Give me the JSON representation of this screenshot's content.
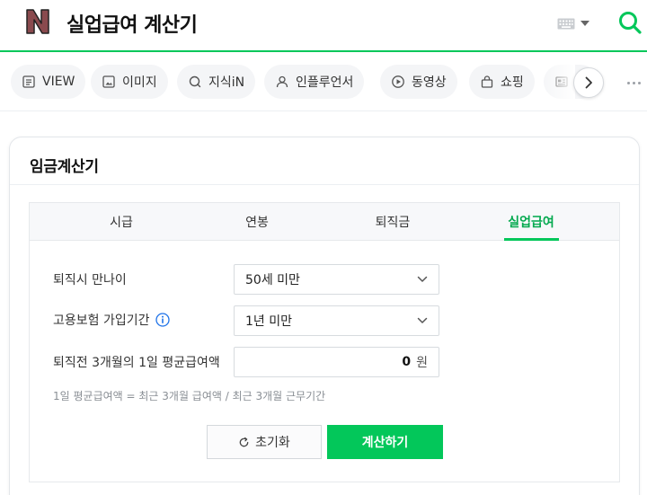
{
  "header": {
    "logo_letter": "N",
    "query": "실업급여 계산기"
  },
  "tabs": [
    {
      "label": "VIEW",
      "icon": "view-icon"
    },
    {
      "label": "이미지",
      "icon": "image-icon"
    },
    {
      "label": "지식iN",
      "icon": "knowledge-icon"
    },
    {
      "label": "인플루언서",
      "icon": "person-icon"
    },
    {
      "label": "동영상",
      "icon": "play-icon"
    },
    {
      "label": "쇼핑",
      "icon": "shopping-bag-icon"
    },
    {
      "label": "",
      "icon": "news-icon"
    }
  ],
  "card": {
    "title": "임금계산기",
    "calc_tabs": [
      "시급",
      "연봉",
      "퇴직금",
      "실업급여"
    ],
    "active_tab": "실업급여",
    "age_label": "퇴직시 만나이",
    "age_value": "50세 미만",
    "period_label": "고용보험 가입기간",
    "period_value": "1년 미만",
    "wage_label": "퇴직전 3개월의 1일 평균급여액",
    "wage_value": "0",
    "wage_unit": "원",
    "formula": "1일 평균급여액 = 최근 3개월 급여액 / 최근 3개월 근무기간",
    "reset_label": "초기화",
    "calc_label": "계산하기"
  },
  "colors": {
    "brand_green": "#03c75a",
    "logo_fill": "#8a4a4e"
  }
}
